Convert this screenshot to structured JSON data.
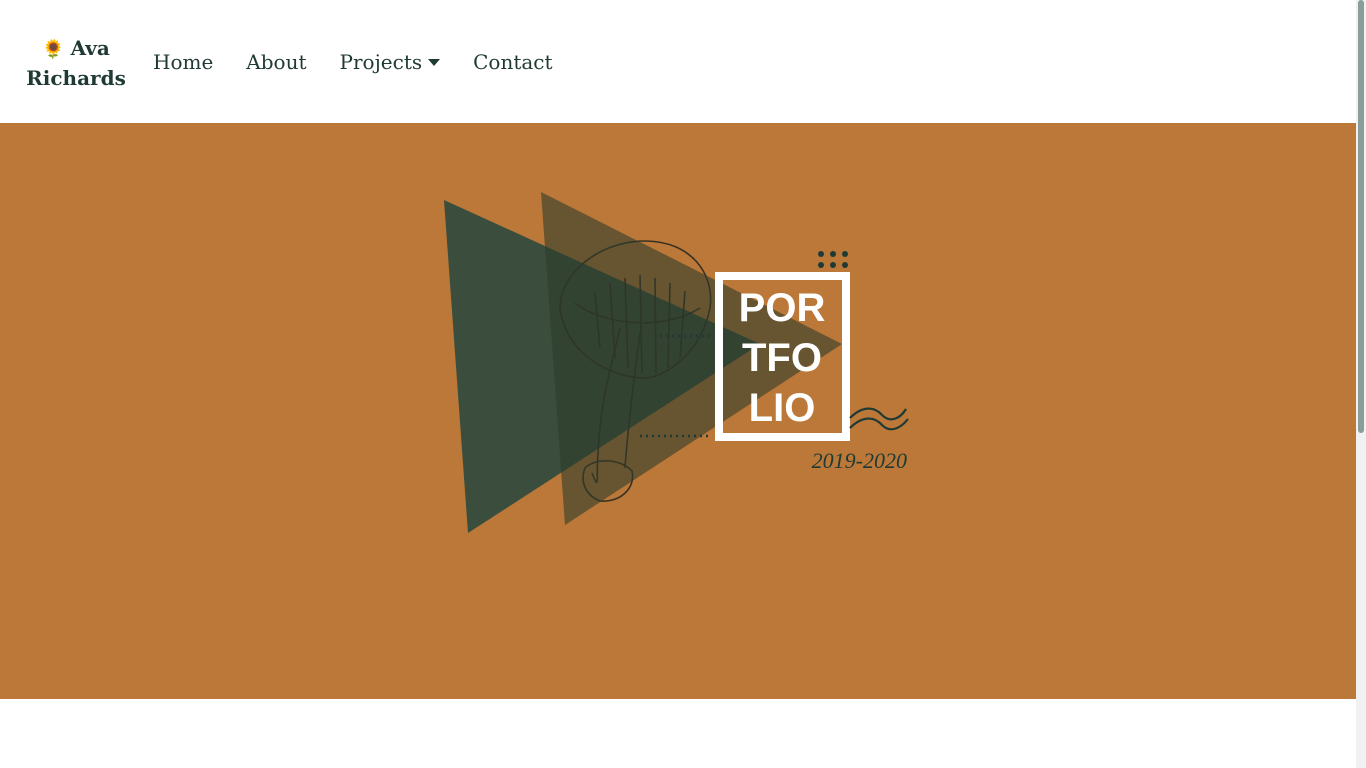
{
  "brand": {
    "emoji": "🌻",
    "name_line1": "Ava",
    "name_line2": "Richards"
  },
  "nav": [
    {
      "label": "Home"
    },
    {
      "label": "About"
    },
    {
      "label": "Projects",
      "has_dropdown": true
    },
    {
      "label": "Contact"
    }
  ],
  "hero": {
    "logo_lines": [
      "POR",
      "TFO",
      "LIO"
    ],
    "years": "2019-2020",
    "background_color": "#bb7838",
    "accent_color": "#1f3a34"
  }
}
